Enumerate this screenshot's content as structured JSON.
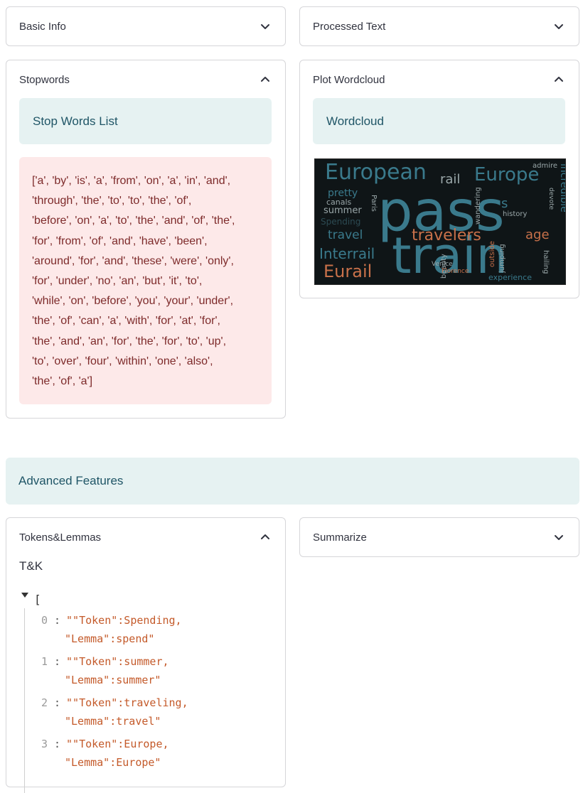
{
  "expanders": {
    "basic_info": {
      "label": "Basic Info"
    },
    "processed_text": {
      "label": "Processed Text"
    },
    "stopwords": {
      "label": "Stopwords",
      "info_title": "Stop Words List",
      "list_lines": [
        "['a', 'by', 'is', 'a', 'from', 'on', 'a', 'in', 'and',",
        "'through', 'the', 'to', 'to', 'the', 'of',",
        "'before', 'on', 'a', 'to', 'the', 'and', 'of', 'the',",
        "'for', 'from', 'of', 'and', 'have', 'been',",
        "'around', 'for', 'and', 'these', 'were', 'only',",
        "'for', 'under', 'no', 'an', 'but', 'it', 'to',",
        "'while', 'on', 'before', 'you', 'your', 'under',",
        "'the', 'of', 'can', 'a', 'with', 'for', 'at', 'for',",
        "'the', 'and', 'an', 'for', 'the', 'for', 'to', 'up',",
        "'to', 'over', 'four', 'within', 'one', 'also',",
        "'the', 'of', 'a']"
      ]
    },
    "plot_wordcloud": {
      "label": "Plot Wordcloud",
      "info_title": "Wordcloud"
    },
    "tokens_lemmas": {
      "label": "Tokens&Lemmas",
      "subtitle": "T&K"
    },
    "summarize": {
      "label": "Summarize"
    }
  },
  "advanced_features": {
    "title": "Advanced Features"
  },
  "json_view": {
    "open_bracket": "[",
    "items": [
      {
        "index": "0",
        "line1": "\"\"Token\":Spending,",
        "line2": "\"Lemma\":spend\""
      },
      {
        "index": "1",
        "line1": "\"\"Token\":summer,",
        "line2": "\"Lemma\":summer\""
      },
      {
        "index": "2",
        "line1": "\"\"Token\":traveling,",
        "line2": "\"Lemma\":travel\""
      },
      {
        "index": "3",
        "line1": "\"\"Token\":Europe,",
        "line2": "\"Lemma\":Europe\""
      }
    ]
  },
  "wordcloud_words": {
    "pass": "pass",
    "train": "train",
    "european": "European",
    "europe": "Europe",
    "travelers": "travelers",
    "age": "age",
    "interrail": "Interrail",
    "eurail": "Eurail",
    "rail": "rail",
    "travel": "travel",
    "summer": "summer",
    "pretty": "pretty",
    "spending": "Spending",
    "history": "history",
    "experience": "experience",
    "incredible": "incredible",
    "admire": "admire",
    "beauty": "beauty",
    "outside": "outside",
    "wandering": "wandering",
    "venice": "Venice",
    "florence": "Florence",
    "canals": "canals",
    "paris": "Paris",
    "s": "s",
    "hailing": "hailing",
    "jumping": "jumping",
    "devote": "devote"
  },
  "colors": {
    "info_bg": "#e6f2f2",
    "info_text": "#1f5566",
    "error_bg": "#fde9e9",
    "error_text": "#7d2a2a",
    "wordcloud_bg": "#0f1517",
    "wordcloud_blue": "#3a7a8c",
    "wordcloud_orange": "#c8714a"
  }
}
